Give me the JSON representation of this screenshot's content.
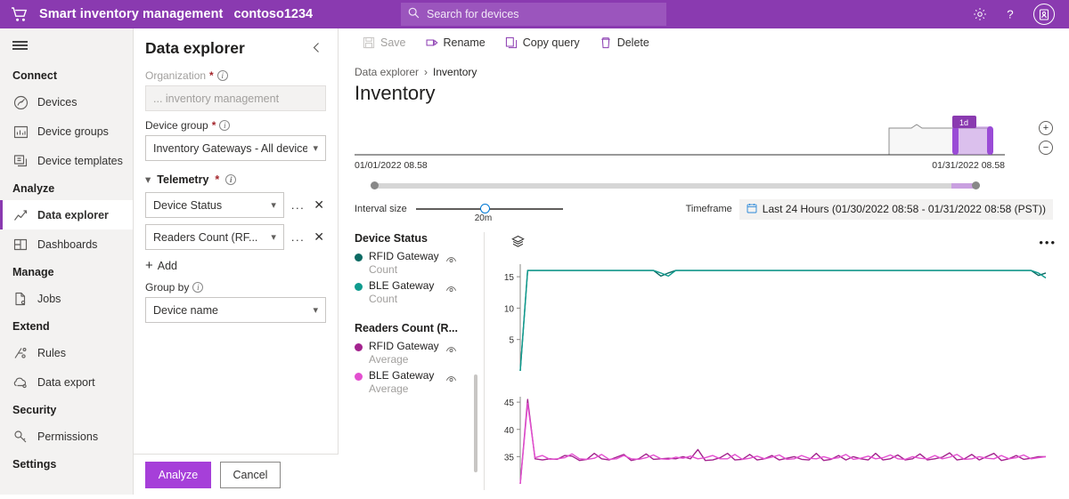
{
  "topbar": {
    "app_title": "Smart inventory management",
    "tenant": "contoso1234",
    "logo_icon": "shopping-cart-icon",
    "search_placeholder": "Search for devices",
    "search_icon": "search-icon",
    "settings_icon": "gear-icon",
    "help_icon": "question-mark-icon",
    "account_icon": "user-badge-icon",
    "accent": "#8a3ab0"
  },
  "nav": {
    "menu_icon": "hamburger-icon",
    "groups": [
      {
        "label": "Connect",
        "items": [
          {
            "label": "Devices",
            "icon": "devices-icon",
            "selected": false
          },
          {
            "label": "Device groups",
            "icon": "device-groups-icon",
            "selected": false
          },
          {
            "label": "Device templates",
            "icon": "device-templates-icon",
            "selected": false
          }
        ]
      },
      {
        "label": "Analyze",
        "items": [
          {
            "label": "Data explorer",
            "icon": "line-chart-icon",
            "selected": true
          },
          {
            "label": "Dashboards",
            "icon": "dashboard-grid-icon",
            "selected": false
          }
        ]
      },
      {
        "label": "Manage",
        "items": [
          {
            "label": "Jobs",
            "icon": "jobs-icon",
            "selected": false
          }
        ]
      },
      {
        "label": "Extend",
        "items": [
          {
            "label": "Rules",
            "icon": "rules-icon",
            "selected": false
          },
          {
            "label": "Data export",
            "icon": "cloud-export-icon",
            "selected": false
          }
        ]
      },
      {
        "label": "Security",
        "items": [
          {
            "label": "Permissions",
            "icon": "key-icon",
            "selected": false
          }
        ]
      },
      {
        "label": "Settings",
        "items": []
      }
    ]
  },
  "panel": {
    "title": "Data explorer",
    "collapse_icon": "chevron-left-icon",
    "organization": {
      "label": "Organization",
      "required": "*",
      "info_icon": "info-icon",
      "value": "... inventory management",
      "disabled": true
    },
    "device_group": {
      "label": "Device group",
      "required": "*",
      "info_icon": "info-icon",
      "value": "Inventory Gateways - All devices",
      "chevron": "chevron-down-icon"
    },
    "telemetry": {
      "label": "Telemetry",
      "required": "*",
      "info_icon": "info-icon",
      "caret": "chevron-down-icon",
      "rows": [
        {
          "value": "Device Status",
          "more": "...",
          "remove": "✕"
        },
        {
          "value": "Readers Count (RF...",
          "more": "...",
          "remove": "✕"
        }
      ],
      "add_label": "Add",
      "add_icon": "plus-icon"
    },
    "group_by": {
      "label": "Group by",
      "info_icon": "info-icon",
      "value": "Device name",
      "chevron": "chevron-down-icon"
    },
    "analyze_label": "Analyze",
    "cancel_label": "Cancel"
  },
  "commandbar": {
    "items": [
      {
        "label": "Save",
        "icon": "save-icon",
        "disabled": true
      },
      {
        "label": "Rename",
        "icon": "rename-icon",
        "disabled": false
      },
      {
        "label": "Copy query",
        "icon": "copy-icon",
        "disabled": false
      },
      {
        "label": "Delete",
        "icon": "trash-icon",
        "disabled": false
      }
    ]
  },
  "page": {
    "breadcrumb_root": "Data explorer",
    "breadcrumb_sep": "›",
    "breadcrumb_current": "Inventory",
    "title": "Inventory"
  },
  "range": {
    "start_label": "01/01/2022 08.58",
    "end_label": "01/31/2022 08.58",
    "brush_label": "1d",
    "zoom_in_icon": "zoom-in-icon",
    "zoom_out_icon": "zoom-out-icon",
    "interval_label": "Interval size",
    "interval_value": "20m",
    "timeframe_label": "Timeframe",
    "timeframe_icon": "calendar-icon",
    "timeframe_value": "Last 24 Hours (01/30/2022 08:58 - 01/31/2022 08:58 (PST))"
  },
  "legend": {
    "groups": [
      {
        "title": "Device Status",
        "series": [
          {
            "name": "RFID Gateway",
            "agg": "Count",
            "color": "#0b6a63",
            "eye_icon": "eye-icon"
          },
          {
            "name": "BLE Gateway",
            "agg": "Count",
            "color": "#0f9b8e",
            "eye_icon": "eye-icon"
          }
        ]
      },
      {
        "title": "Readers Count (R...",
        "series": [
          {
            "name": "RFID Gateway",
            "agg": "Average",
            "color": "#a3238e",
            "eye_icon": "eye-icon"
          },
          {
            "name": "BLE Gateway",
            "agg": "Average",
            "color": "#e34fd0",
            "eye_icon": "eye-icon"
          }
        ]
      }
    ]
  },
  "plot": {
    "layers_icon": "layers-icon",
    "more_icon": "ellipsis-icon"
  },
  "chart_data": [
    {
      "type": "line",
      "title": "Device Status",
      "xlabel": "",
      "ylabel": "",
      "ylim": [
        0,
        17
      ],
      "yticks": [
        5,
        10,
        15
      ],
      "grid": false,
      "legend_position": "left",
      "x": [
        0,
        1,
        2,
        3,
        4,
        5,
        6,
        7,
        8,
        9,
        10,
        11,
        12,
        13,
        14,
        15,
        16,
        17,
        18,
        19,
        20,
        21,
        22,
        23,
        24,
        25,
        26,
        27,
        28,
        29,
        30,
        31,
        32,
        33,
        34,
        35,
        36,
        37,
        38,
        39,
        40,
        41,
        42,
        43,
        44,
        45,
        46,
        47,
        48,
        49,
        50,
        51,
        52,
        53,
        54,
        55,
        56,
        57,
        58,
        59,
        60,
        61,
        62,
        63,
        64,
        65,
        66,
        67,
        68,
        69,
        70,
        71
      ],
      "series": [
        {
          "name": "RFID Gateway Count",
          "color": "#0b6a63",
          "values": [
            0,
            16,
            16,
            16,
            16,
            16,
            16,
            16,
            16,
            16,
            16,
            16,
            16,
            16,
            16,
            16,
            16,
            16,
            16,
            15.1,
            15.6,
            16,
            16,
            16,
            16,
            16,
            16,
            16,
            16,
            16,
            16,
            16,
            16,
            16,
            16,
            16,
            16,
            16,
            16,
            16,
            16,
            16,
            16,
            16,
            16,
            16,
            16,
            16,
            16,
            16,
            16,
            16,
            16,
            16,
            16,
            16,
            16,
            16,
            16,
            16,
            16,
            16,
            16,
            16,
            16,
            16,
            16,
            16,
            16,
            16,
            15.2,
            15.6
          ]
        },
        {
          "name": "BLE Gateway Count",
          "color": "#0f9b8e",
          "values": [
            0,
            16,
            16,
            16,
            16,
            16,
            16,
            16,
            16,
            16,
            16,
            16,
            16,
            16,
            16,
            16,
            16,
            16,
            16,
            15.6,
            15.1,
            16,
            16,
            16,
            16,
            16,
            16,
            16,
            16,
            16,
            16,
            16,
            16,
            16,
            16,
            16,
            16,
            16,
            16,
            16,
            16,
            16,
            16,
            16,
            16,
            16,
            16,
            16,
            16,
            16,
            16,
            16,
            16,
            16,
            16,
            16,
            16,
            16,
            16,
            16,
            16,
            16,
            16,
            16,
            16,
            16,
            16,
            16,
            16,
            16,
            15.6,
            14.8
          ]
        }
      ]
    },
    {
      "type": "line",
      "title": "Readers Count (Reads)",
      "xlabel": "",
      "ylabel": "",
      "ylim": [
        30,
        46
      ],
      "yticks": [
        35,
        40,
        45
      ],
      "grid": false,
      "legend_position": "left",
      "x": [
        0,
        1,
        2,
        3,
        4,
        5,
        6,
        7,
        8,
        9,
        10,
        11,
        12,
        13,
        14,
        15,
        16,
        17,
        18,
        19,
        20,
        21,
        22,
        23,
        24,
        25,
        26,
        27,
        28,
        29,
        30,
        31,
        32,
        33,
        34,
        35,
        36,
        37,
        38,
        39,
        40,
        41,
        42,
        43,
        44,
        45,
        46,
        47,
        48,
        49,
        50,
        51,
        52,
        53,
        54,
        55,
        56,
        57,
        58,
        59,
        60,
        61,
        62,
        63,
        64,
        65,
        66,
        67,
        68,
        69,
        70,
        71
      ],
      "series": [
        {
          "name": "RFID Gateway Average",
          "color": "#a3238e",
          "values": [
            30,
            45.5,
            34.6,
            34.4,
            34.6,
            34.5,
            35.2,
            35.1,
            34.3,
            34.5,
            35.6,
            34.6,
            34.4,
            34.9,
            35.4,
            34.3,
            34.6,
            35.5,
            34.5,
            34.6,
            34.7,
            34.6,
            35.0,
            34.6,
            36.3,
            34.3,
            34.4,
            34.8,
            35.6,
            34.4,
            34.5,
            35.4,
            34.4,
            34.6,
            35.2,
            34.4,
            34.7,
            35.0,
            34.5,
            34.4,
            35.6,
            34.3,
            34.5,
            35.2,
            34.4,
            35.0,
            34.6,
            34.4,
            35.6,
            34.4,
            34.6,
            35.3,
            34.4,
            34.6,
            35.5,
            34.4,
            34.6,
            34.9,
            35.7,
            34.4,
            34.6,
            35.4,
            34.4,
            35.0,
            35.6,
            34.3,
            34.6,
            35.2,
            34.5,
            34.7,
            35.0,
            35.0
          ]
        },
        {
          "name": "BLE Gateway Average",
          "color": "#e34fd0",
          "values": [
            30,
            44.8,
            34.8,
            35.2,
            34.5,
            34.6,
            34.8,
            35.5,
            34.6,
            34.5,
            34.7,
            35.4,
            34.5,
            34.6,
            35.2,
            34.6,
            34.5,
            34.8,
            35.3,
            34.6,
            34.5,
            34.9,
            34.7,
            35.1,
            34.6,
            34.8,
            35.2,
            34.6,
            34.6,
            35.4,
            34.5,
            34.7,
            35.1,
            34.6,
            34.9,
            35.3,
            34.5,
            34.6,
            35.2,
            34.7,
            34.6,
            35.0,
            34.6,
            34.8,
            35.4,
            34.5,
            34.7,
            35.1,
            34.6,
            34.8,
            35.3,
            34.6,
            34.5,
            35.0,
            34.7,
            34.6,
            35.2,
            34.6,
            34.9,
            35.4,
            34.5,
            34.6,
            35.0,
            34.7,
            34.6,
            35.2,
            34.6,
            34.8,
            35.3,
            34.6,
            34.8,
            35.0
          ]
        }
      ]
    }
  ]
}
